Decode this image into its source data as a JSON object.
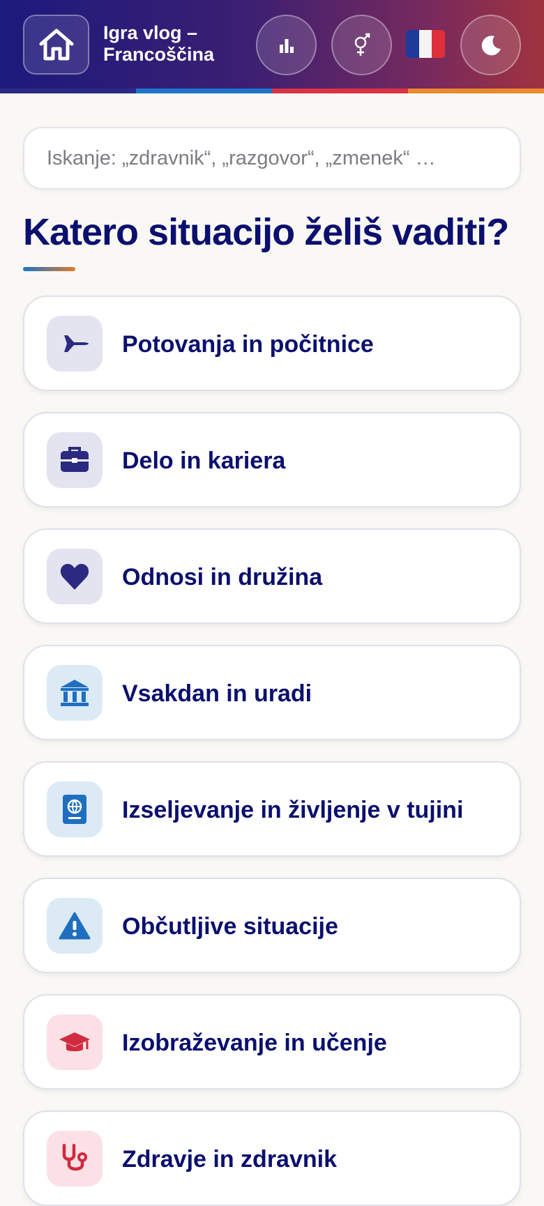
{
  "header": {
    "title_line1": "Igra vlog –",
    "title_line2": "Francoščina",
    "stripe_colors": [
      "#2b2a85",
      "#1f73c8",
      "#d93344",
      "#e98a2f"
    ]
  },
  "search": {
    "placeholder": "Iskanje: „zdravnik“, „razgovor“, „zmenek“ …"
  },
  "heading": "Katero situacijo želiš vaditi?",
  "categories": [
    {
      "label": "Potovanja in počitnice",
      "icon": "airplane-icon",
      "tint": "#e4e4f1",
      "color": "#2b2a80"
    },
    {
      "label": "Delo in kariera",
      "icon": "briefcase-icon",
      "tint": "#e4e4f1",
      "color": "#2b2a80"
    },
    {
      "label": "Odnosi in družina",
      "icon": "heart-icon",
      "tint": "#e4e4f1",
      "color": "#2b2a80"
    },
    {
      "label": "Vsakdan in uradi",
      "icon": "building-icon",
      "tint": "#dceaf6",
      "color": "#1f6fc0"
    },
    {
      "label": "Izseljevanje in življenje v tujini",
      "icon": "passport-icon",
      "tint": "#dceaf6",
      "color": "#1f6fc0"
    },
    {
      "label": "Občutljive situacije",
      "icon": "warning-icon",
      "tint": "#dceaf6",
      "color": "#1f6fc0"
    },
    {
      "label": "Izobraževanje in učenje",
      "icon": "graduation-cap-icon",
      "tint": "#fbe1e5",
      "color": "#d02b3f"
    },
    {
      "label": "Zdravje in zdravnik",
      "icon": "stethoscope-icon",
      "tint": "#fbe1e5",
      "color": "#d02b3f"
    }
  ]
}
